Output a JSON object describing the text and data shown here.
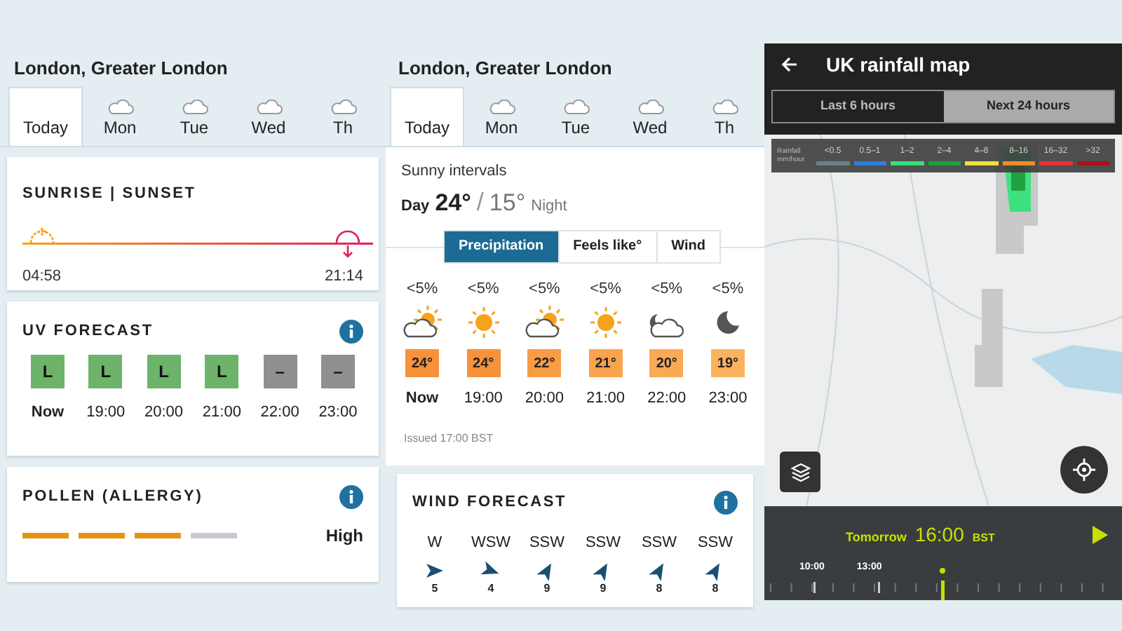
{
  "left": {
    "location": "London, Greater London",
    "tabs": [
      {
        "label": "Today",
        "selected": true
      },
      {
        "label": "Mon",
        "selected": false
      },
      {
        "label": "Tue",
        "selected": false
      },
      {
        "label": "Wed",
        "selected": false
      },
      {
        "label": "Th",
        "selected": false
      }
    ],
    "sun": {
      "title": "SUNRISE | SUNSET",
      "sunrise": "04:58",
      "sunset": "21:14"
    },
    "uv": {
      "title": "UV FORECAST",
      "items": [
        {
          "value": "L",
          "time": "Now",
          "color": "#6db36a",
          "current": true
        },
        {
          "value": "L",
          "time": "19:00",
          "color": "#6db36a",
          "current": false
        },
        {
          "value": "L",
          "time": "20:00",
          "color": "#6db36a",
          "current": false
        },
        {
          "value": "L",
          "time": "21:00",
          "color": "#6db36a",
          "current": false
        },
        {
          "value": "–",
          "time": "22:00",
          "color": "#8f8f8f",
          "current": false
        },
        {
          "value": "–",
          "time": "23:00",
          "color": "#8f8f8f",
          "current": false
        }
      ]
    },
    "pollen": {
      "title": "POLLEN (ALLERGY)",
      "level": 0.75,
      "reading": "High"
    }
  },
  "middle": {
    "location": "London, Greater London",
    "tabs": [
      {
        "label": "Today",
        "selected": true
      },
      {
        "label": "Mon",
        "selected": false
      },
      {
        "label": "Tue",
        "selected": false
      },
      {
        "label": "Wed",
        "selected": false
      },
      {
        "label": "Th",
        "selected": false
      }
    ],
    "summary": "Sunny intervals",
    "day_label": "Day",
    "day_temp": "24°",
    "separator": "/",
    "night_temp": "15°",
    "night_label": "Night",
    "modes": [
      {
        "label": "Precipitation",
        "selected": true
      },
      {
        "label": "Feels like°",
        "selected": false
      },
      {
        "label": "Wind",
        "selected": false
      }
    ],
    "hours": [
      {
        "chance": "<5%",
        "kind": "sun-cloud",
        "temp": "24°",
        "color": "#f7913a",
        "time": "Now",
        "current": true
      },
      {
        "chance": "<5%",
        "kind": "sun",
        "temp": "24°",
        "color": "#f7913a",
        "time": "19:00",
        "current": false
      },
      {
        "chance": "<5%",
        "kind": "sun-cloud",
        "temp": "22°",
        "color": "#f89c45",
        "time": "20:00",
        "current": false
      },
      {
        "chance": "<5%",
        "kind": "sun",
        "temp": "21°",
        "color": "#f9a34d",
        "time": "21:00",
        "current": false
      },
      {
        "chance": "<5%",
        "kind": "moon-cloud",
        "temp": "20°",
        "color": "#faa955",
        "time": "22:00",
        "current": false
      },
      {
        "chance": "<5%",
        "kind": "moon",
        "temp": "19°",
        "color": "#fbb25f",
        "time": "23:00",
        "current": false
      }
    ],
    "issued": "Issued 17:00 BST",
    "wind": {
      "title": "WIND FORECAST",
      "items": [
        {
          "direction": "W",
          "kind": "east",
          "speed": "5"
        },
        {
          "direction": "WSW",
          "kind": "east-north",
          "speed": "4"
        },
        {
          "direction": "SSW",
          "kind": "north",
          "speed": "9"
        },
        {
          "direction": "SSW",
          "kind": "north",
          "speed": "9"
        },
        {
          "direction": "SSW",
          "kind": "north",
          "speed": "8"
        },
        {
          "direction": "SSW",
          "kind": "north",
          "speed": "8"
        }
      ]
    }
  },
  "map": {
    "title": "UK rainfall map",
    "ranges": [
      {
        "label": "Last 6 hours",
        "selected": false
      },
      {
        "label": "Next 24 hours",
        "selected": true
      }
    ],
    "legend": {
      "title": "Rainfall mm/hour",
      "items": [
        {
          "label": "<0.5",
          "color": "#6b7f8c"
        },
        {
          "label": "0.5–1",
          "color": "#2f7de1"
        },
        {
          "label": "1–2",
          "color": "#35e07a"
        },
        {
          "label": "2–4",
          "color": "#1aa33a"
        },
        {
          "label": "4–8",
          "color": "#f2e03a"
        },
        {
          "label": "8–16",
          "color": "#f08a24"
        },
        {
          "label": "16–32",
          "color": "#e8303a"
        },
        {
          "label": ">32",
          "color": "#b0101a"
        }
      ]
    },
    "day": "Tomorrow",
    "time": "16:00",
    "zone": "BST",
    "ticks": [
      "10:00",
      "13:00"
    ]
  }
}
